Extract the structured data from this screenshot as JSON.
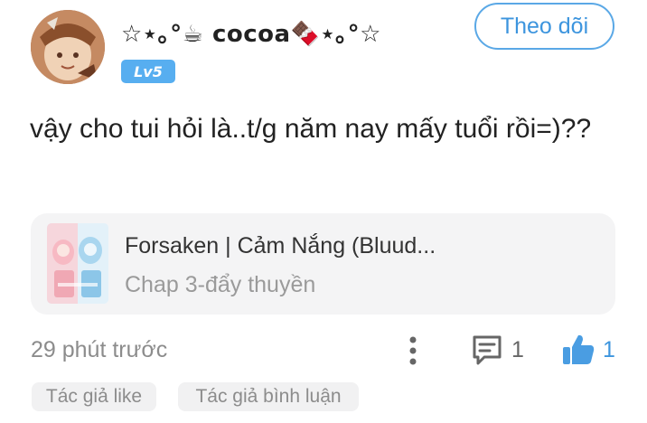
{
  "user": {
    "name": "☆⋆｡°☕ cocoa🍫⋆｡°☆",
    "level": "Lv5"
  },
  "follow_button": {
    "label": "Theo dõi"
  },
  "comment": {
    "text": "vậy cho tui hỏi là..t/g năm nay mấy tuổi rồi=)??"
  },
  "story": {
    "title": "Forsaken | Cảm Nắng (Bluud...",
    "chapter": "Chap 3-đẩy thuyền"
  },
  "meta": {
    "timestamp": "29 phút trước",
    "comment_count": "1",
    "like_count": "1"
  },
  "tags": [
    "Tác giả like",
    "Tác giả bình luận"
  ],
  "icons": [
    "more-vertical-icon",
    "comment-icon",
    "thumbs-up-icon"
  ],
  "colors": {
    "accent": "#3d95de",
    "badge": "#57aef0",
    "muted": "#8c8c8c",
    "card_bg": "#f4f4f5"
  }
}
